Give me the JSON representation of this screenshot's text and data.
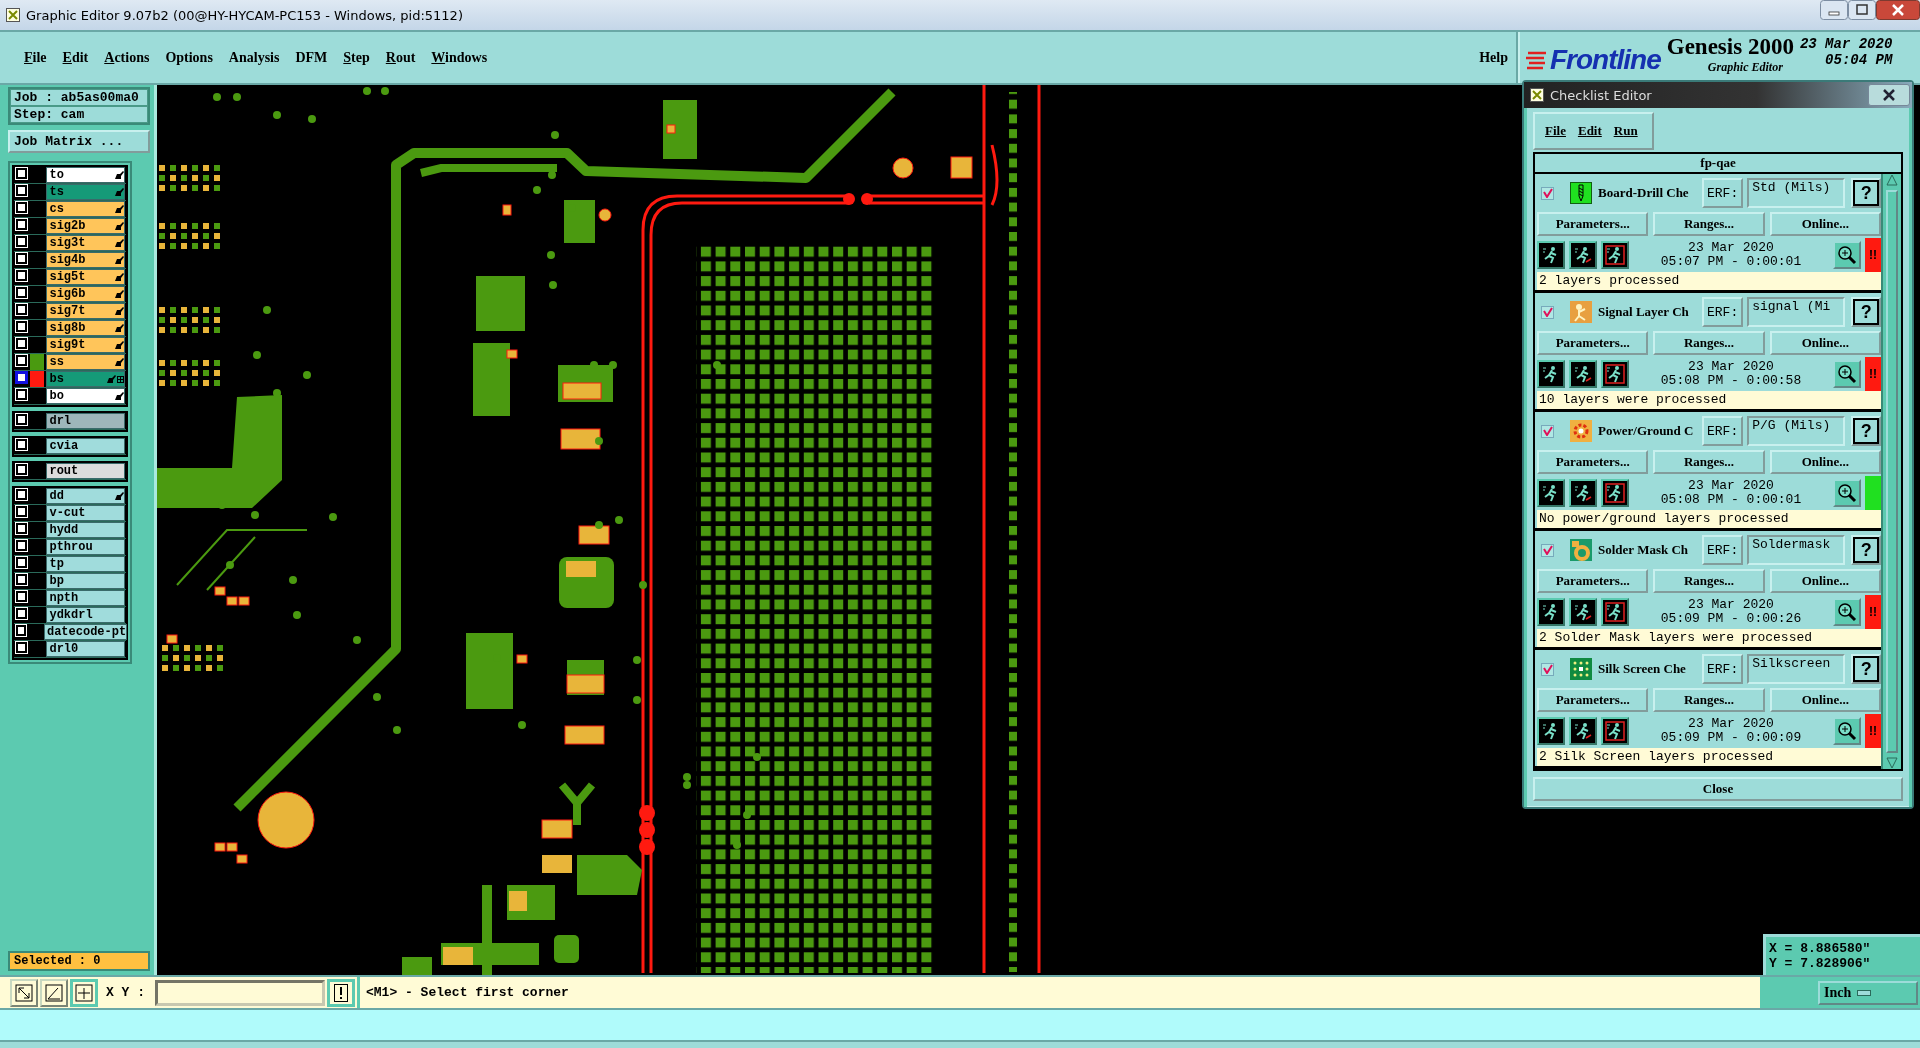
{
  "window": {
    "title": "Graphic Editor 9.07b2 (00@HY-HYCAM-PC153 - Windows, pid:5112)"
  },
  "menu": [
    {
      "label": "File",
      "mnemonic": true
    },
    {
      "label": "Edit",
      "mnemonic": true
    },
    {
      "label": "Actions",
      "mnemonic": true
    },
    {
      "label": "Options",
      "mnemonic": false
    },
    {
      "label": "Analysis",
      "mnemonic": false
    },
    {
      "label": "DFM",
      "mnemonic": false
    },
    {
      "label": "Step",
      "mnemonic": true
    },
    {
      "label": "Rout",
      "mnemonic": true
    },
    {
      "label": "Windows",
      "mnemonic": true
    }
  ],
  "help": "Help",
  "branding": {
    "logo": "Frontline",
    "product": "Genesis 2000",
    "subtitle": "Graphic Editor",
    "date": "23 Mar 2020",
    "time": "05:04 PM"
  },
  "job": {
    "job": "Job : ab5as00ma0",
    "step": "Step: cam",
    "matrix_button": "Job Matrix ..."
  },
  "layer_groups": [
    {
      "layers": [
        {
          "name": "to",
          "color": "#ffffff",
          "checked": false,
          "affected": true,
          "work": false
        },
        {
          "name": "ts",
          "color": "#159a78",
          "checked": false,
          "affected": true,
          "work": false
        },
        {
          "name": "cs",
          "color": "#ffc55a",
          "checked": false,
          "affected": true,
          "work": false
        },
        {
          "name": "sig2b",
          "color": "#ffc55a",
          "checked": false,
          "affected": true,
          "work": false
        },
        {
          "name": "sig3t",
          "color": "#ffc55a",
          "checked": false,
          "affected": true,
          "work": false
        },
        {
          "name": "sig4b",
          "color": "#ffc55a",
          "checked": false,
          "affected": true,
          "work": false
        },
        {
          "name": "sig5t",
          "color": "#ffc55a",
          "checked": false,
          "affected": true,
          "work": false
        },
        {
          "name": "sig6b",
          "color": "#ffc55a",
          "checked": false,
          "affected": true,
          "work": false
        },
        {
          "name": "sig7t",
          "color": "#ffc55a",
          "checked": false,
          "affected": true,
          "work": false
        },
        {
          "name": "sig8b",
          "color": "#ffc55a",
          "checked": false,
          "affected": true,
          "work": false
        },
        {
          "name": "sig9t",
          "color": "#ffc55a",
          "checked": false,
          "affected": true,
          "work": false
        },
        {
          "name": "ss",
          "color": "#ffc55a",
          "checked": false,
          "affected": true,
          "work": false,
          "swatch": {
            "color": "#4a9a10"
          }
        },
        {
          "name": "bs",
          "color": "#159a78",
          "checked": false,
          "affected": true,
          "work": true,
          "swatch": {
            "color": "#ff1a10"
          }
        },
        {
          "name": "bo",
          "color": "#ffffff",
          "checked": false,
          "affected": true,
          "work": false
        }
      ]
    },
    {
      "layers": [
        {
          "name": "drl",
          "color": "#9eb6ba",
          "checked": false,
          "affected": false,
          "work": false
        }
      ]
    },
    {
      "layers": [
        {
          "name": "cvia",
          "color": "#a0dcdc",
          "checked": false,
          "affected": false,
          "work": false
        }
      ]
    },
    {
      "layers": [
        {
          "name": "rout",
          "color": "#dcdcdc",
          "checked": false,
          "affected": false,
          "work": false
        }
      ]
    },
    {
      "layers": [
        {
          "name": "dd",
          "color": "#a0dcdc",
          "checked": false,
          "affected": true,
          "work": false
        },
        {
          "name": "v-cut",
          "color": "#a0dcdc",
          "checked": false,
          "affected": false,
          "work": false
        },
        {
          "name": "hydd",
          "color": "#a0dcdc",
          "checked": false,
          "affected": false,
          "work": false
        },
        {
          "name": "pthrou",
          "color": "#a0dcdc",
          "checked": false,
          "affected": false,
          "work": false
        },
        {
          "name": "tp",
          "color": "#a0dcdc",
          "checked": false,
          "affected": false,
          "work": false
        },
        {
          "name": "bp",
          "color": "#a0dcdc",
          "checked": false,
          "affected": false,
          "work": false
        },
        {
          "name": "npth",
          "color": "#a0dcdc",
          "checked": false,
          "affected": false,
          "work": false
        },
        {
          "name": "ydkdrl",
          "color": "#a0dcdc",
          "checked": false,
          "affected": false,
          "work": false
        },
        {
          "name": "datecode-pt",
          "color": "#a0dcdc",
          "checked": false,
          "affected": false,
          "work": false
        },
        {
          "name": "drl0",
          "color": "#a0dcdc",
          "checked": false,
          "affected": false,
          "work": false
        }
      ]
    }
  ],
  "selected": "Selected : 0",
  "checklist_editor": {
    "title": "Checklist Editor",
    "menu": [
      "File",
      "Edit",
      "Run"
    ],
    "checklist": "fp-qae",
    "checks": [
      {
        "name": "Board-Drill Che",
        "checked": true,
        "kind": "drill",
        "erf_label": "ERF:",
        "erf": "Std (Mils)",
        "help": "?",
        "buttons": [
          "Parameters...",
          "Ranges...",
          "Online..."
        ],
        "date": "23 Mar 2020",
        "time": "05:07 PM - 0:00:01",
        "passed": false,
        "result_mark": "!!",
        "message": "2 layers processed"
      },
      {
        "name": "Signal Layer Ch",
        "checked": true,
        "kind": "signal",
        "erf_label": "ERF:",
        "erf": "signal (Mi",
        "help": "?",
        "buttons": [
          "Parameters...",
          "Ranges...",
          "Online..."
        ],
        "date": "23 Mar 2020",
        "time": "05:08 PM - 0:00:58",
        "passed": false,
        "result_mark": "!!",
        "message": "10 layers were processed"
      },
      {
        "name": "Power/Ground C",
        "checked": true,
        "kind": "power",
        "erf_label": "ERF:",
        "erf": "P/G (Mils)",
        "help": "?",
        "buttons": [
          "Parameters...",
          "Ranges...",
          "Online..."
        ],
        "date": "23 Mar 2020",
        "time": "05:08 PM - 0:00:01",
        "passed": true,
        "message": "No power/ground layers processed"
      },
      {
        "name": "Solder Mask Ch",
        "checked": true,
        "kind": "mask",
        "erf_label": "ERF:",
        "erf": "Soldermask",
        "help": "?",
        "buttons": [
          "Parameters...",
          "Ranges...",
          "Online..."
        ],
        "date": "23 Mar 2020",
        "time": "05:09 PM - 0:00:26",
        "passed": false,
        "result_mark": "!!",
        "message": "2 Solder Mask layers were processed"
      },
      {
        "name": "Silk Screen Che",
        "checked": true,
        "kind": "silk",
        "erf_label": "ERF:",
        "erf": "Silkscreen",
        "help": "?",
        "buttons": [
          "Parameters...",
          "Ranges...",
          "Online..."
        ],
        "date": "23 Mar 2020",
        "time": "05:09 PM - 0:00:09",
        "passed": false,
        "result_mark": "!!",
        "message": "2 Silk Screen layers processed"
      }
    ],
    "close": "Close"
  },
  "coordinates": {
    "x": "X = 8.886580\"",
    "y": "Y = 7.828906\""
  },
  "status_bar": {
    "xy_label": "X Y :",
    "message": "<M1> - Select first corner",
    "units": "Inch"
  }
}
